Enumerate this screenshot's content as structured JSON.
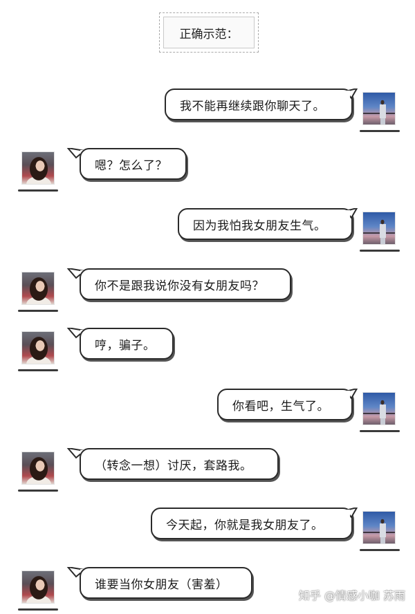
{
  "header": {
    "title": "正确示范："
  },
  "messages": [
    {
      "side": "right",
      "text": "我不能再继续跟你聊天了。"
    },
    {
      "side": "left",
      "text": "嗯？怎么了？"
    },
    {
      "side": "right",
      "text": "因为我怕我女朋友生气。"
    },
    {
      "side": "left",
      "text": "你不是跟我说你没有女朋友吗？"
    },
    {
      "side": "left",
      "text": "哼，骗子。"
    },
    {
      "side": "right",
      "text": "你看吧，生气了。"
    },
    {
      "side": "left",
      "text": "（转念一想）讨厌，套路我。"
    },
    {
      "side": "right",
      "text": "今天起，你就是我女朋友了。"
    },
    {
      "side": "left",
      "text": "谁要当你女朋友（害羞）"
    }
  ],
  "watermark": "知乎 @情感小咖 苏雨"
}
